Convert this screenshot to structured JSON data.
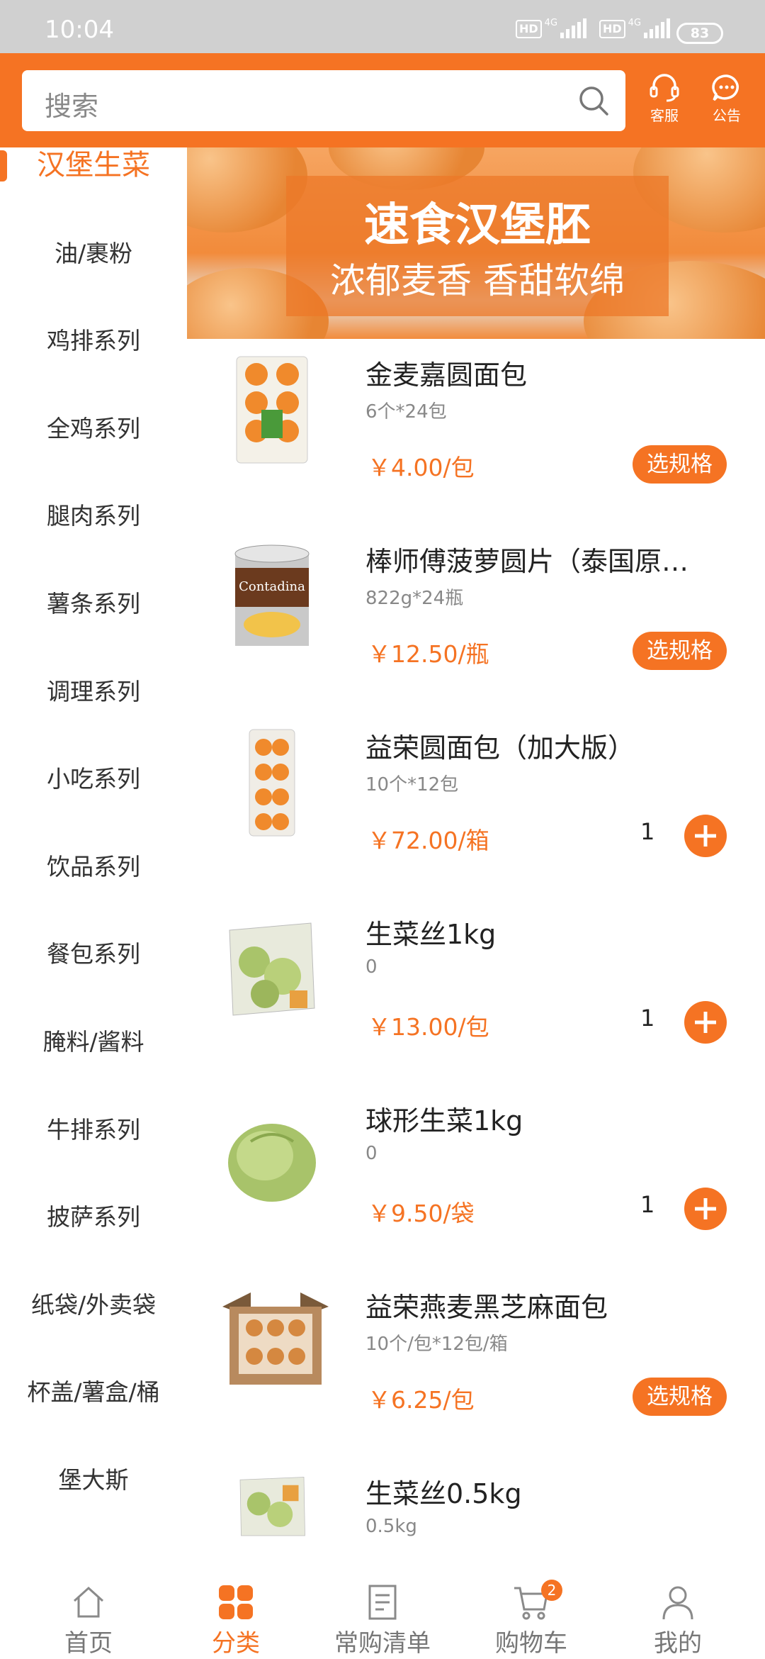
{
  "status_bar": {
    "time": "10:04",
    "battery": "83",
    "net1": "HD",
    "net2": "HD",
    "gen": "4G"
  },
  "header": {
    "search_placeholder": "搜索",
    "service_label": "客服",
    "notice_label": "公告"
  },
  "banner": {
    "title": "速食汉堡胚",
    "subtitle": "浓郁麦香 香甜软绵"
  },
  "categories": [
    {
      "label": "汉堡生菜",
      "active": true
    },
    {
      "label": "油/裹粉"
    },
    {
      "label": "鸡排系列"
    },
    {
      "label": "全鸡系列"
    },
    {
      "label": "腿肉系列"
    },
    {
      "label": "薯条系列"
    },
    {
      "label": "调理系列"
    },
    {
      "label": "小吃系列"
    },
    {
      "label": "饮品系列"
    },
    {
      "label": "餐包系列"
    },
    {
      "label": "腌料/酱料"
    },
    {
      "label": "牛排系列"
    },
    {
      "label": "披萨系列"
    },
    {
      "label": "纸袋/外卖袋"
    },
    {
      "label": "杯盖/薯盒/桶"
    },
    {
      "label": "堡大斯"
    }
  ],
  "products": [
    {
      "name": "金麦嘉圆面包",
      "spec": "6个*24包",
      "price": "￥4.00/包",
      "action": "选规格"
    },
    {
      "name": "棒师傅菠萝圆片（泰国原…",
      "spec": "822g*24瓶",
      "price": "￥12.50/瓶",
      "action": "选规格"
    },
    {
      "name": "益荣圆面包（加大版）",
      "spec": "10个*12包",
      "price": "￥72.00/箱",
      "qty": "1"
    },
    {
      "name": "生菜丝1kg",
      "spec": "0",
      "price": "￥13.00/包",
      "qty": "1"
    },
    {
      "name": "球形生菜1kg",
      "spec": "0",
      "price": "￥9.50/袋",
      "qty": "1"
    },
    {
      "name": "益荣燕麦黑芝麻面包",
      "spec": "10个/包*12包/箱",
      "price": "￥6.25/包",
      "action": "选规格"
    },
    {
      "name": "生菜丝0.5kg",
      "spec": "0.5kg",
      "price": "",
      "action": ""
    }
  ],
  "bottom_nav": [
    {
      "label": "首页",
      "icon": "home-icon"
    },
    {
      "label": "分类",
      "icon": "category-icon",
      "active": true
    },
    {
      "label": "常购清单",
      "icon": "list-icon"
    },
    {
      "label": "购物车",
      "icon": "cart-icon",
      "badge": "2"
    },
    {
      "label": "我的",
      "icon": "user-icon"
    }
  ],
  "colors": {
    "accent": "#f57323",
    "status_bar": "#d0d0d0"
  }
}
